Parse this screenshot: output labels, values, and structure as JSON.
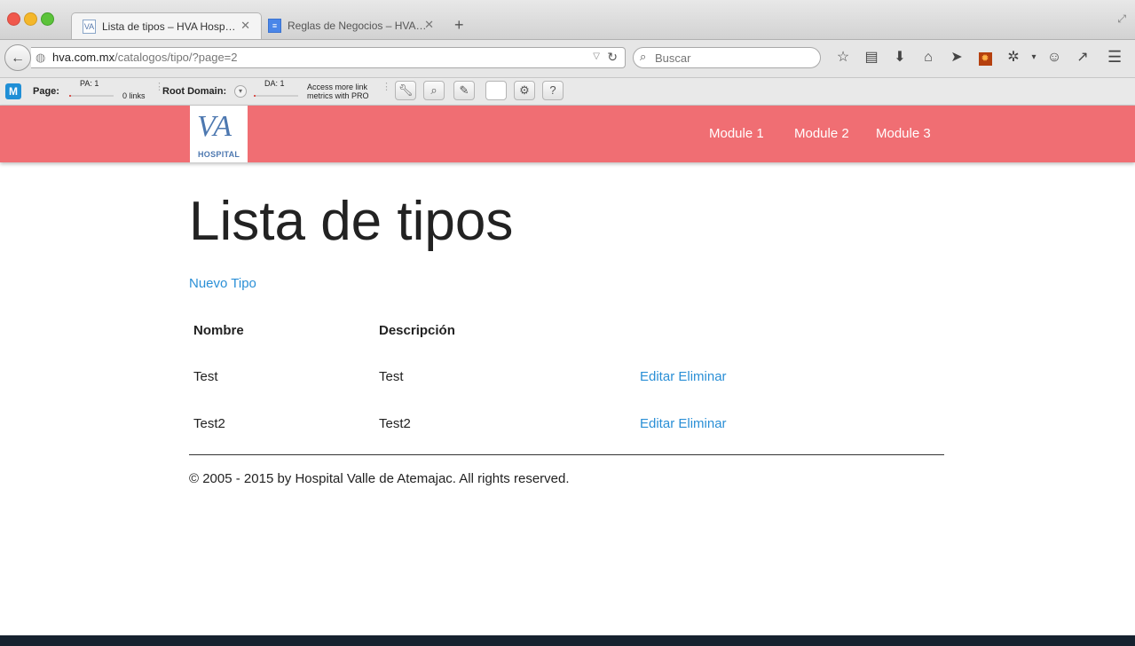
{
  "browser": {
    "tabs": [
      {
        "title": "Lista de tipos – HVA Hosp…",
        "favicon": "VA",
        "active": true
      },
      {
        "title": "Reglas de Negocios – HVA…",
        "favicon": "doc",
        "active": false
      }
    ],
    "url_host": "hva.com.mx",
    "url_path": "/catalogos/tipo/?page=2",
    "search_placeholder": "Buscar",
    "nav_icons": [
      "star-icon",
      "reading-list-icon",
      "download-icon",
      "home-icon",
      "send-icon",
      "extension-icon",
      "bug-icon",
      "dropdown-icon",
      "chat-icon",
      "pin-icon"
    ],
    "menu_icon": "hamburger-icon"
  },
  "mozbar": {
    "logo": "M",
    "page_label": "Page:",
    "pa": "PA: 1",
    "links": "0 links",
    "root_domain_label": "Root Domain:",
    "da": "DA: 1",
    "promo_line1": "Access more link",
    "promo_line2": "metrics with PRO",
    "tools": [
      "wrench-icon",
      "search-icon",
      "pencil-icon",
      "blank-icon",
      "gear-icon",
      "help-icon"
    ]
  },
  "header": {
    "logo_mark": "VA",
    "logo_sub": "HOSPITAL",
    "nav": [
      "Module 1",
      "Module 2",
      "Module 3"
    ],
    "color": "#f06e73"
  },
  "main": {
    "title": "Lista de tipos",
    "new_link": "Nuevo Tipo",
    "table": {
      "headers": [
        "Nombre",
        "Descripción"
      ],
      "rows": [
        {
          "nombre": "Test",
          "descripcion": "Test",
          "edit": "Editar",
          "delete": "Eliminar"
        },
        {
          "nombre": "Test2",
          "descripcion": "Test2",
          "edit": "Editar",
          "delete": "Eliminar"
        }
      ]
    }
  },
  "footer": {
    "text": "© 2005 - 2015 by Hospital Valle de Atemajac. All rights reserved."
  }
}
